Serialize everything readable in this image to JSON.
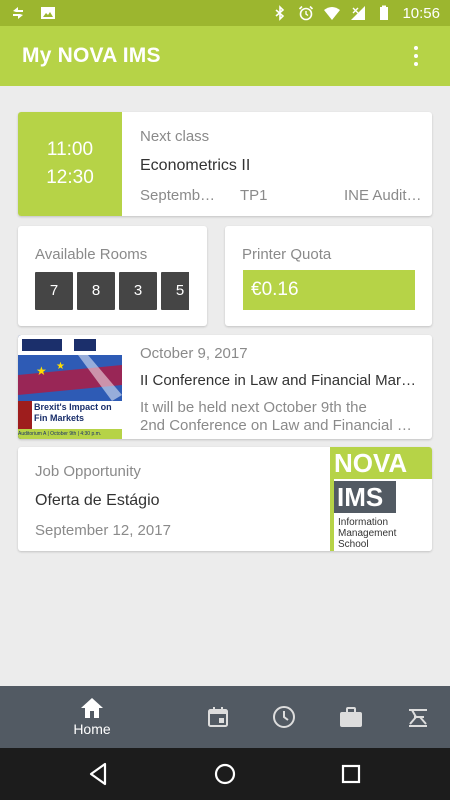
{
  "status_bar": {
    "time": "10:56"
  },
  "app_bar": {
    "title": "My NOVA IMS",
    "menu_icon": "more-vert-icon"
  },
  "next_class": {
    "start": "11:00",
    "end": "12:30",
    "label": "Next class",
    "course": "Econometrics II",
    "date": "Septemb…",
    "type": "TP1",
    "room": "INE Audit…"
  },
  "rooms": {
    "label": "Available Rooms",
    "values": [
      "7",
      "8",
      "3",
      "5"
    ]
  },
  "printer": {
    "label": "Printer Quota",
    "value": "€0.16"
  },
  "news": {
    "date": "October 9, 2017",
    "title": "II Conference in Law and Financial Mark…",
    "desc_line1": "It will be held next October 9th the",
    "desc_line2": "2nd Conference on Law and Financial M…",
    "image_text": "Brexit's Impact on Fin Markets",
    "image_footer": "Auditorium A | October 9th | 4:30 p.m."
  },
  "job": {
    "label": "Job Opportunity",
    "title": "Oferta de Estágio",
    "date": "September 12, 2017",
    "logo_top": "NOVA",
    "logo_mid": "IMS",
    "logo_sub1": "Information",
    "logo_sub2": "Management",
    "logo_sub3": "School"
  },
  "bottom_nav": {
    "home_label": "Home",
    "items": [
      "home-icon",
      "calendar-icon",
      "clock-icon",
      "briefcase-icon",
      "printer-icon"
    ]
  },
  "colors": {
    "accent": "#b6d347",
    "statusbar": "#9cb62f",
    "nav": "#525a63"
  }
}
